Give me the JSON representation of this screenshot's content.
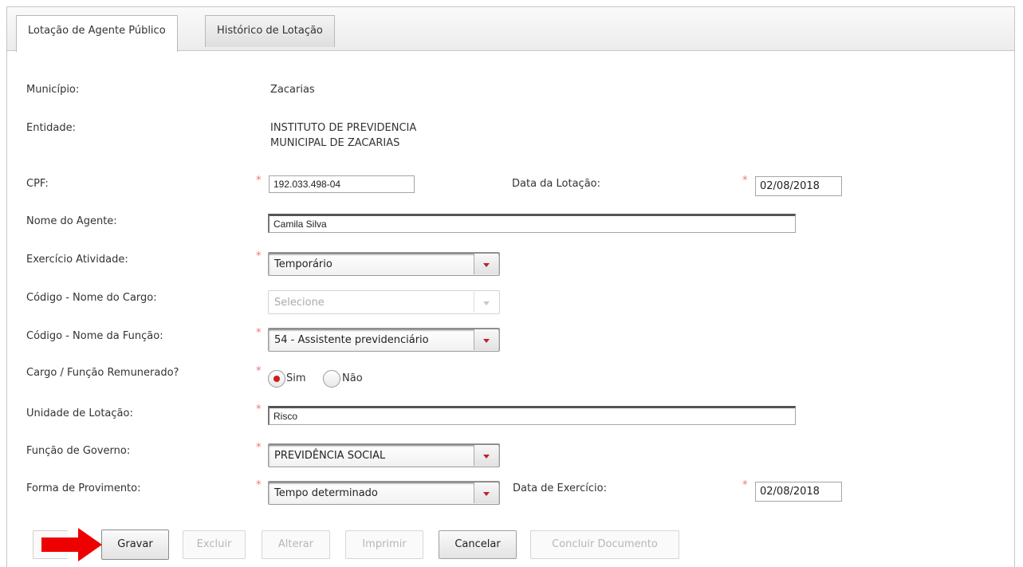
{
  "tabs": [
    {
      "label": "Lotação de Agente Público",
      "active": true
    },
    {
      "label": "Histórico de Lotação",
      "active": false
    }
  ],
  "form": {
    "municipio": {
      "label": "Município:",
      "value": "Zacarias"
    },
    "entidade": {
      "label": "Entidade:",
      "line1": "INSTITUTO DE PREVIDENCIA",
      "line2": "MUNICIPAL DE ZACARIAS"
    },
    "cpf": {
      "label": "CPF:",
      "value": "192.033.498-04"
    },
    "data_lotacao": {
      "label": "Data da Lotação:",
      "value": "02/08/2018"
    },
    "nome_agente": {
      "label": "Nome do Agente:",
      "value": "Camila Silva"
    },
    "exercicio_atividade": {
      "label": "Exercício Atividade:",
      "value": "Temporário"
    },
    "codigo_cargo": {
      "label": "Código - Nome do Cargo:",
      "value": "Selecione"
    },
    "codigo_funcao": {
      "label": "Código - Nome da Função:",
      "value": "54 - Assistente previdenciário"
    },
    "remunerado": {
      "label": "Cargo / Função Remunerado?",
      "option_yes": "Sim",
      "option_no": "Não",
      "selected": "Sim"
    },
    "unidade_lotacao": {
      "label": "Unidade de Lotação:",
      "value": "Risco"
    },
    "funcao_governo": {
      "label": "Função de Governo:",
      "value": "PREVIDÊNCIA SOCIAL"
    },
    "forma_provimento": {
      "label": "Forma de Provimento:",
      "value": "Tempo determinado"
    },
    "data_exercicio": {
      "label": "Data de Exercício:",
      "value": "02/08/2018"
    },
    "required_mark": "*"
  },
  "buttons": {
    "gravar": "Gravar",
    "excluir": "Excluir",
    "alterar": "Alterar",
    "imprimir": "Imprimir",
    "cancelar": "Cancelar",
    "concluir": "Concluir Documento"
  },
  "colors": {
    "required": "#e87878",
    "annotation_arrow": "#ee0000",
    "dropdown_arrow": "#c0202a"
  }
}
